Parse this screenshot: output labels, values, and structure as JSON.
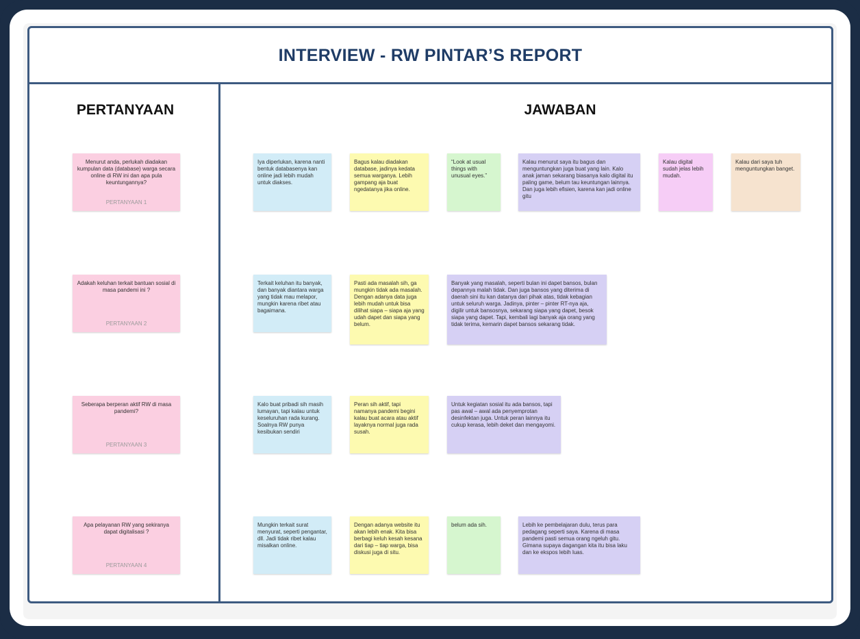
{
  "board": {
    "title": "INTERVIEW - RW PINTAR’S REPORT",
    "questions_header": "PERTANYAAN",
    "answers_header": "JAWABAN"
  },
  "questions": [
    {
      "text": "Menurut anda, perlukah diadakan kumpulan data (database) warga secara online di RW ini dan apa pula keuntungannya?",
      "label": "PERTANYAAN 1"
    },
    {
      "text": "Adakah keluhan terkait bantuan sosial di masa pandemi ini ?",
      "label": "PERTANYAAN 2"
    },
    {
      "text": "Seberapa berperan aktif RW di masa pandemi?",
      "label": "PERTANYAAN 3"
    },
    {
      "text": "Apa pelayanan RW yang sekiranya dapat digitalisasi ?",
      "label": "PERTANYAAN 4"
    }
  ],
  "answers": {
    "row1": [
      "Iya diperlukan, karena nanti bentuk databasenya kan online jadi lebih mudah untuk diakses.",
      "Bagus kalau diadakan database, jadinya kedata semua warganya. Lebih gampang aja buat ngedatanya jika online.",
      "“Look at usual things with unusual eyes.”",
      "Kalau menurut saya itu bagus dan menguntungkan juga buat yang lain. Kalo anak jaman sekarang biasanya kalo digital itu paling game, belum tau keuntungan lainnya. Dan juga lebih efisien, karena kan jadi online gitu",
      "Kalau digital sudah jelas lebih mudah.",
      "Kalau dari saya tuh menguntungkan banget."
    ],
    "row2": [
      "Terkait keluhan itu banyak, dan banyak diantara warga yang tidak mau melapor, mungkin karena ribet atau bagaimana.",
      "Pasti ada masalah sih, ga mungkin tidak ada masalah. Dengan adanya data juga lebih mudah untuk bisa dilihat siapa – siapa aja yang udah dapet dan siapa yang belum.",
      "Banyak yang masalah, seperti bulan ini dapet bansos, bulan depannya malah tidak. Dan juga bansos yang diterima di daerah sini itu kan datanya dari pihak atas, tidak kebagian untuk seluruh warga. Jadinya, pinter – pinter RT-nya aja, digilir untuk bansosnya, sekarang siapa yang dapet, besok siapa yang dapet. Tapi, kembali lagi banyak aja orang yang tidak terima, kemarin dapet bansos sekarang tidak."
    ],
    "row3": [
      "Kalo buat pribadi sih masih lumayan, tapi kalau untuk keseluruhan rada kurang. Soalnya RW punya kesibukan sendiri",
      "Peran sih aktif, tapi namanya pandemi begini kalau buat acara atau aktif layaknya normal juga rada susah.",
      "Untuk kegiatan sosial itu ada bansos, tapi pas awal – awal ada penyemprotan desinfektan juga. Untuk peran lainnya itu cukup kerasa, lebih deket dan mengayomi."
    ],
    "row4": [
      "Mungkin terkait surat menyurat, seperti pengantar, dll. Jadi tidak ribet kalau misalkan online.",
      "Dengan adanya website itu akan lebih enak. Kita bisa berbagi keluh kesah kesana dari tiap – tiap warga, bisa diskusi juga di situ.",
      "belum ada sih.",
      "Lebih ke pembelajaran dulu, terus para pedagang seperti saya. Karena di masa pandemi pasti semua orang ngeluh gitu. Gimana supaya dagangan kita itu bisa laku dan ke ekspos lebih luas."
    ]
  },
  "colors": {
    "frame": "#1b2d45",
    "board_border": "#3d5a80",
    "title": "#1f3c66",
    "question_note": "#fbcfe1",
    "answer_blue": "#d2ecf7",
    "answer_yellow": "#fdfab0",
    "answer_green": "#d6f6cf",
    "answer_purple": "#d6d0f4",
    "answer_magenta": "#f6cdf6",
    "answer_peach": "#f6e3cf"
  }
}
